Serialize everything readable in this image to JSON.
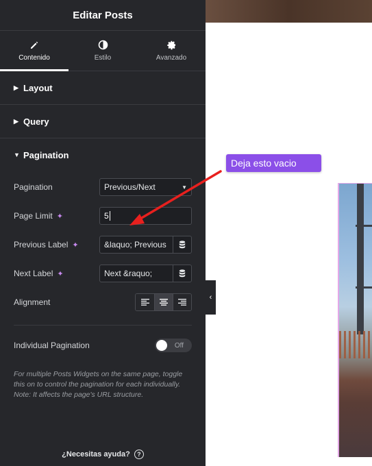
{
  "panel": {
    "title": "Editar Posts",
    "tabs": [
      {
        "label": "Contenido",
        "icon": "pencil-icon"
      },
      {
        "label": "Estilo",
        "icon": "half-circle-icon"
      },
      {
        "label": "Avanzado",
        "icon": "gear-icon"
      }
    ],
    "sections": {
      "layout": "Layout",
      "query": "Query",
      "pagination": "Pagination"
    },
    "controls": {
      "pagination_label": "Pagination",
      "pagination_value": "Previous/Next",
      "page_limit_label": "Page Limit",
      "page_limit_value": "5",
      "previous_label_label": "Previous Label",
      "previous_label_value": "&laquo; Previous",
      "next_label_label": "Next Label",
      "next_label_value": "Next &raquo;",
      "alignment_label": "Alignment",
      "alignment_selected": "center",
      "individual_label": "Individual Pagination",
      "individual_toggle": "Off",
      "note": "For multiple Posts Widgets on the same page, toggle this on to control the pagination for each individually. Note: It affects the page's URL structure."
    },
    "help": "¿Necesitas ayuda?"
  },
  "annotation": {
    "text": "Deja esto vacio",
    "color": "#8b4fe8",
    "arrow_color": "#e8201e"
  }
}
